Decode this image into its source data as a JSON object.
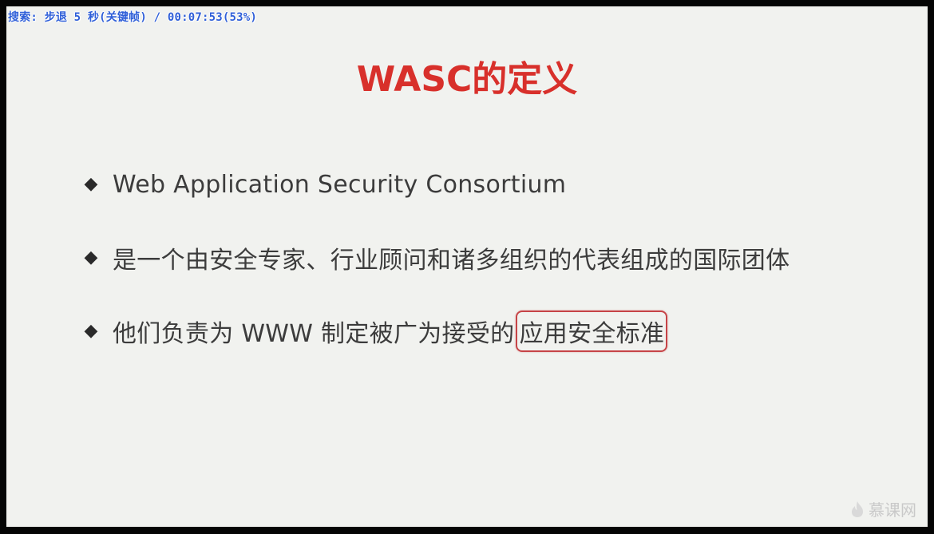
{
  "player": {
    "osd_text": "搜索: 步退 5 秒(关键帧) / 00:07:53(53%)"
  },
  "slide": {
    "title": "WASC的定义",
    "bullets": [
      {
        "text": "Web Application Security Consortium",
        "highlight": ""
      },
      {
        "text": "是一个由安全专家、行业顾问和诸多组织的代表组成的国际团体",
        "highlight": ""
      },
      {
        "text": "他们负责为 WWW 制定被广为接受的",
        "highlight": "应用安全标准"
      }
    ],
    "bullet_icon": "diamond-icon"
  },
  "watermark": {
    "icon": "flame-icon",
    "text": "慕课网"
  },
  "colors": {
    "title": "#d8302b",
    "osd": "#2f5fd8",
    "highlight_border": "#c64447",
    "slide_bg": "#f1f2ef"
  }
}
